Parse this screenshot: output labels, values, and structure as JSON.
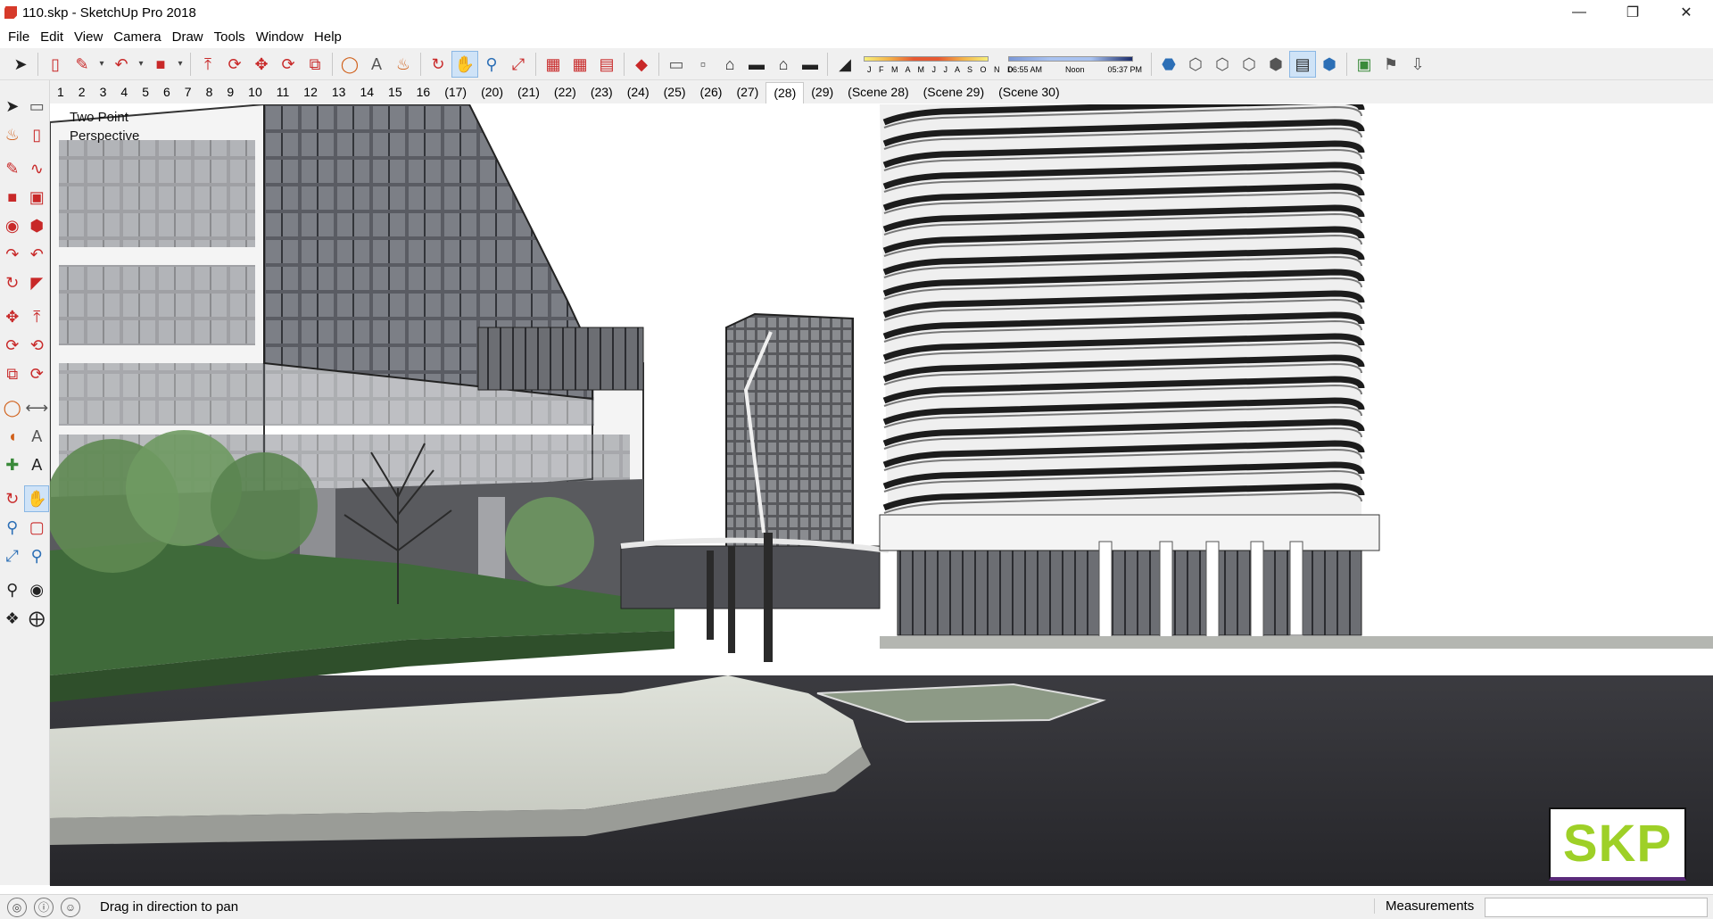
{
  "window": {
    "title": "110.skp - SketchUp Pro 2018"
  },
  "menu": [
    "File",
    "Edit",
    "View",
    "Camera",
    "Draw",
    "Tools",
    "Window",
    "Help"
  ],
  "shadow_settings": {
    "months": "J F M A M J J A S O N D",
    "time_start": "06:55 AM",
    "time_mid": "Noon",
    "time_end": "05:37 PM"
  },
  "scene_tabs": [
    "1",
    "2",
    "3",
    "4",
    "5",
    "6",
    "7",
    "8",
    "9",
    "10",
    "11",
    "12",
    "13",
    "14",
    "15",
    "16",
    "(17)",
    "(20)",
    "(21)",
    "(22)",
    "(23)",
    "(24)",
    "(25)",
    "(26)",
    "(27)",
    "(28)",
    "(29)",
    "(Scene 28)",
    "(Scene 29)",
    "(Scene 30)"
  ],
  "active_scene": "(28)",
  "viewport": {
    "view_label_1": "Two Point",
    "view_label_2": "Perspective",
    "logo_text": "SKP"
  },
  "status": {
    "message": "Drag in direction to pan",
    "measurements_label": "Measurements",
    "measurements_value": ""
  },
  "colors": {
    "accent_active": "#cfe3f7",
    "logo_green": "#9ed027",
    "ground_dark": "#2e2e32"
  }
}
